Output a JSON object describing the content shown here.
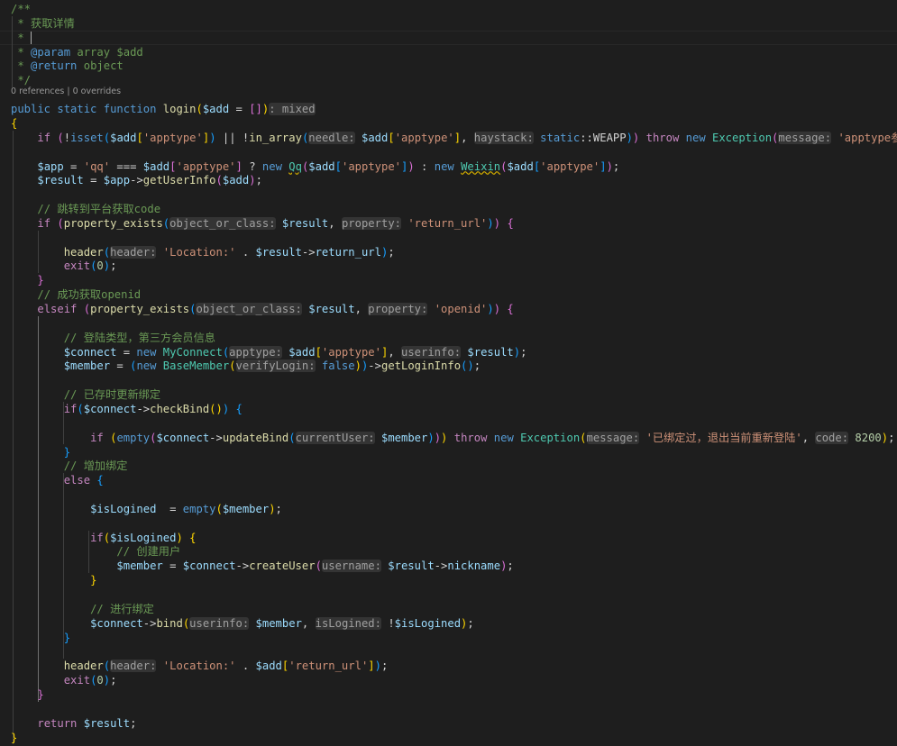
{
  "codelens": "0 references | 0 overrides",
  "lines": [
    [
      [
        "/**",
        "cm"
      ]
    ],
    [
      [
        " * 获取详情",
        "cm"
      ]
    ],
    [
      [
        " * ",
        "cm"
      ]
    ],
    [
      [
        " * ",
        "cm"
      ],
      [
        "@param",
        "doc"
      ],
      [
        " array $add",
        "cm"
      ]
    ],
    [
      [
        " * ",
        "cm"
      ],
      [
        "@return",
        "doc"
      ],
      [
        " object",
        "cm"
      ]
    ],
    [
      [
        " */",
        "cm"
      ]
    ],
    [
      [
        "public",
        "kw"
      ],
      [
        " ",
        "plain"
      ],
      [
        "static",
        "kw"
      ],
      [
        " ",
        "plain"
      ],
      [
        "function",
        "kw"
      ],
      [
        " ",
        "plain"
      ],
      [
        "login",
        "fn"
      ],
      [
        "(",
        "br1"
      ],
      [
        "$add",
        "var"
      ],
      [
        " = ",
        "op"
      ],
      [
        "[]",
        "br2"
      ],
      [
        ")",
        "br1"
      ],
      [
        ": mixed",
        "hint"
      ]
    ],
    [
      [
        "{",
        "br1"
      ]
    ],
    [
      [
        "    ",
        "plain"
      ],
      [
        "if",
        "ctl"
      ],
      [
        " ",
        "plain"
      ],
      [
        "(",
        "br2"
      ],
      [
        "!",
        "op"
      ],
      [
        "isset",
        "kw"
      ],
      [
        "(",
        "br3"
      ],
      [
        "$add",
        "var"
      ],
      [
        "[",
        "br1"
      ],
      [
        "'apptype'",
        "str"
      ],
      [
        "]",
        "br1"
      ],
      [
        ")",
        "br3"
      ],
      [
        " || !",
        "op"
      ],
      [
        "in_array",
        "fn"
      ],
      [
        "(",
        "br3"
      ],
      [
        "needle:",
        "hint"
      ],
      [
        " ",
        "plain"
      ],
      [
        "$add",
        "var"
      ],
      [
        "[",
        "br1"
      ],
      [
        "'apptype'",
        "str"
      ],
      [
        "]",
        "br1"
      ],
      [
        ", ",
        "op"
      ],
      [
        "haystack:",
        "hint"
      ],
      [
        " ",
        "plain"
      ],
      [
        "static",
        "kw"
      ],
      [
        "::",
        "op"
      ],
      [
        "WEAPP",
        "plain"
      ],
      [
        ")",
        "br3"
      ],
      [
        ")",
        "br2"
      ],
      [
        " ",
        "plain"
      ],
      [
        "throw",
        "ctl"
      ],
      [
        " ",
        "plain"
      ],
      [
        "new",
        "kw"
      ],
      [
        " ",
        "plain"
      ],
      [
        "Exception",
        "cls"
      ],
      [
        "(",
        "br2"
      ],
      [
        "message:",
        "hint"
      ],
      [
        " ",
        "plain"
      ],
      [
        "'apptype参数错误",
        "str"
      ]
    ],
    [],
    [
      [
        "    ",
        "plain"
      ],
      [
        "$app",
        "var"
      ],
      [
        " = ",
        "op"
      ],
      [
        "'qq'",
        "str"
      ],
      [
        " === ",
        "op"
      ],
      [
        "$add",
        "var"
      ],
      [
        "[",
        "br2"
      ],
      [
        "'apptype'",
        "str"
      ],
      [
        "]",
        "br2"
      ],
      [
        " ? ",
        "op"
      ],
      [
        "new",
        "kw"
      ],
      [
        " ",
        "plain"
      ],
      [
        "Qq",
        "cls sq"
      ],
      [
        "(",
        "br2"
      ],
      [
        "$add",
        "var"
      ],
      [
        "[",
        "br3"
      ],
      [
        "'apptype'",
        "str"
      ],
      [
        "]",
        "br3"
      ],
      [
        ")",
        "br2"
      ],
      [
        " : ",
        "op"
      ],
      [
        "new",
        "kw"
      ],
      [
        " ",
        "plain"
      ],
      [
        "Weixin",
        "cls sq"
      ],
      [
        "(",
        "br2"
      ],
      [
        "$add",
        "var"
      ],
      [
        "[",
        "br3"
      ],
      [
        "'apptype'",
        "str"
      ],
      [
        "]",
        "br3"
      ],
      [
        ")",
        "br2"
      ],
      [
        ";",
        "op"
      ]
    ],
    [
      [
        "    ",
        "plain"
      ],
      [
        "$result",
        "var"
      ],
      [
        " = ",
        "op"
      ],
      [
        "$app",
        "var"
      ],
      [
        "->",
        "op"
      ],
      [
        "getUserInfo",
        "fn"
      ],
      [
        "(",
        "br2"
      ],
      [
        "$add",
        "var"
      ],
      [
        ")",
        "br2"
      ],
      [
        ";",
        "op"
      ]
    ],
    [],
    [
      [
        "    ",
        "plain"
      ],
      [
        "// 跳转到平台获取code",
        "cm"
      ]
    ],
    [
      [
        "    ",
        "plain"
      ],
      [
        "if",
        "ctl"
      ],
      [
        " ",
        "plain"
      ],
      [
        "(",
        "br2"
      ],
      [
        "property_exists",
        "fn"
      ],
      [
        "(",
        "br3"
      ],
      [
        "object_or_class:",
        "hint"
      ],
      [
        " ",
        "plain"
      ],
      [
        "$result",
        "var"
      ],
      [
        ", ",
        "op"
      ],
      [
        "property:",
        "hint"
      ],
      [
        " ",
        "plain"
      ],
      [
        "'return_url'",
        "str"
      ],
      [
        ")",
        "br3"
      ],
      [
        ")",
        "br2"
      ],
      [
        " ",
        "plain"
      ],
      [
        "{",
        "br2"
      ]
    ],
    [],
    [
      [
        "        ",
        "plain"
      ],
      [
        "header",
        "fn"
      ],
      [
        "(",
        "br3"
      ],
      [
        "header:",
        "hint"
      ],
      [
        " ",
        "plain"
      ],
      [
        "'Location:'",
        "str"
      ],
      [
        " . ",
        "op"
      ],
      [
        "$result",
        "var"
      ],
      [
        "->",
        "op"
      ],
      [
        "return_url",
        "var"
      ],
      [
        ")",
        "br3"
      ],
      [
        ";",
        "op"
      ]
    ],
    [
      [
        "        ",
        "plain"
      ],
      [
        "exit",
        "ctl"
      ],
      [
        "(",
        "br3"
      ],
      [
        "0",
        "num"
      ],
      [
        ")",
        "br3"
      ],
      [
        ";",
        "op"
      ]
    ],
    [
      [
        "    ",
        "plain"
      ],
      [
        "}",
        "br2"
      ]
    ],
    [
      [
        "    ",
        "plain"
      ],
      [
        "// 成功获取openid",
        "cm"
      ]
    ],
    [
      [
        "    ",
        "plain"
      ],
      [
        "elseif",
        "ctl"
      ],
      [
        " ",
        "plain"
      ],
      [
        "(",
        "br2"
      ],
      [
        "property_exists",
        "fn"
      ],
      [
        "(",
        "br3"
      ],
      [
        "object_or_class:",
        "hint"
      ],
      [
        " ",
        "plain"
      ],
      [
        "$result",
        "var"
      ],
      [
        ", ",
        "op"
      ],
      [
        "property:",
        "hint"
      ],
      [
        " ",
        "plain"
      ],
      [
        "'openid'",
        "str"
      ],
      [
        ")",
        "br3"
      ],
      [
        ")",
        "br2"
      ],
      [
        " ",
        "plain"
      ],
      [
        "{",
        "br2"
      ]
    ],
    [],
    [
      [
        "        ",
        "plain"
      ],
      [
        "// 登陆类型，第三方会员信息",
        "cm"
      ]
    ],
    [
      [
        "        ",
        "plain"
      ],
      [
        "$connect",
        "var"
      ],
      [
        " = ",
        "op"
      ],
      [
        "new",
        "kw"
      ],
      [
        " ",
        "plain"
      ],
      [
        "MyConnect",
        "cls"
      ],
      [
        "(",
        "br3"
      ],
      [
        "apptype:",
        "hint"
      ],
      [
        " ",
        "plain"
      ],
      [
        "$add",
        "var"
      ],
      [
        "[",
        "br1"
      ],
      [
        "'apptype'",
        "str"
      ],
      [
        "]",
        "br1"
      ],
      [
        ", ",
        "op"
      ],
      [
        "userinfo:",
        "hint"
      ],
      [
        " ",
        "plain"
      ],
      [
        "$result",
        "var"
      ],
      [
        ")",
        "br3"
      ],
      [
        ";",
        "op"
      ]
    ],
    [
      [
        "        ",
        "plain"
      ],
      [
        "$member",
        "var"
      ],
      [
        " = ",
        "op"
      ],
      [
        "(",
        "br3"
      ],
      [
        "new",
        "kw"
      ],
      [
        " ",
        "plain"
      ],
      [
        "BaseMember",
        "cls"
      ],
      [
        "(",
        "br1"
      ],
      [
        "verifyLogin:",
        "hint"
      ],
      [
        " ",
        "plain"
      ],
      [
        "false",
        "kw"
      ],
      [
        ")",
        "br1"
      ],
      [
        ")",
        "br3"
      ],
      [
        "->",
        "op"
      ],
      [
        "getLoginInfo",
        "fn"
      ],
      [
        "(",
        "br3"
      ],
      [
        ")",
        "br3"
      ],
      [
        ";",
        "op"
      ]
    ],
    [],
    [
      [
        "        ",
        "plain"
      ],
      [
        "// 已存时更新绑定",
        "cm"
      ]
    ],
    [
      [
        "        ",
        "plain"
      ],
      [
        "if",
        "ctl"
      ],
      [
        "(",
        "br3"
      ],
      [
        "$connect",
        "var"
      ],
      [
        "->",
        "op"
      ],
      [
        "checkBind",
        "fn"
      ],
      [
        "(",
        "br1"
      ],
      [
        ")",
        "br1"
      ],
      [
        ")",
        "br3"
      ],
      [
        " ",
        "plain"
      ],
      [
        "{",
        "br3"
      ]
    ],
    [],
    [
      [
        "            ",
        "plain"
      ],
      [
        "if",
        "ctl"
      ],
      [
        " ",
        "plain"
      ],
      [
        "(",
        "br1"
      ],
      [
        "empty",
        "kw"
      ],
      [
        "(",
        "br2"
      ],
      [
        "$connect",
        "var"
      ],
      [
        "->",
        "op"
      ],
      [
        "updateBind",
        "fn"
      ],
      [
        "(",
        "br3"
      ],
      [
        "currentUser:",
        "hint"
      ],
      [
        " ",
        "plain"
      ],
      [
        "$member",
        "var"
      ],
      [
        ")",
        "br3"
      ],
      [
        ")",
        "br2"
      ],
      [
        ")",
        "br1"
      ],
      [
        " ",
        "plain"
      ],
      [
        "throw",
        "ctl"
      ],
      [
        " ",
        "plain"
      ],
      [
        "new",
        "kw"
      ],
      [
        " ",
        "plain"
      ],
      [
        "Exception",
        "cls"
      ],
      [
        "(",
        "br1"
      ],
      [
        "message:",
        "hint"
      ],
      [
        " ",
        "plain"
      ],
      [
        "'已绑定过，退出当前重新登陆'",
        "str"
      ],
      [
        ", ",
        "op"
      ],
      [
        "code:",
        "hint"
      ],
      [
        " ",
        "plain"
      ],
      [
        "8200",
        "num"
      ],
      [
        ")",
        "br1"
      ],
      [
        ";",
        "op"
      ]
    ],
    [
      [
        "        ",
        "plain"
      ],
      [
        "}",
        "br3"
      ]
    ],
    [
      [
        "        ",
        "plain"
      ],
      [
        "// 增加绑定",
        "cm"
      ]
    ],
    [
      [
        "        ",
        "plain"
      ],
      [
        "else",
        "ctl"
      ],
      [
        " ",
        "plain"
      ],
      [
        "{",
        "br3"
      ]
    ],
    [],
    [
      [
        "            ",
        "plain"
      ],
      [
        "$isLogined",
        "var"
      ],
      [
        "  = ",
        "op"
      ],
      [
        "empty",
        "kw"
      ],
      [
        "(",
        "br1"
      ],
      [
        "$member",
        "var"
      ],
      [
        ")",
        "br1"
      ],
      [
        ";",
        "op"
      ]
    ],
    [],
    [
      [
        "            ",
        "plain"
      ],
      [
        "if",
        "ctl"
      ],
      [
        "(",
        "br1"
      ],
      [
        "$isLogined",
        "var"
      ],
      [
        ")",
        "br1"
      ],
      [
        " ",
        "plain"
      ],
      [
        "{",
        "br1"
      ]
    ],
    [
      [
        "                ",
        "plain"
      ],
      [
        "// 创建用户",
        "cm"
      ]
    ],
    [
      [
        "                ",
        "plain"
      ],
      [
        "$member",
        "var"
      ],
      [
        " = ",
        "op"
      ],
      [
        "$connect",
        "var"
      ],
      [
        "->",
        "op"
      ],
      [
        "createUser",
        "fn"
      ],
      [
        "(",
        "br2"
      ],
      [
        "username:",
        "hint"
      ],
      [
        " ",
        "plain"
      ],
      [
        "$result",
        "var"
      ],
      [
        "->",
        "op"
      ],
      [
        "nickname",
        "var"
      ],
      [
        ")",
        "br2"
      ],
      [
        ";",
        "op"
      ]
    ],
    [
      [
        "            ",
        "plain"
      ],
      [
        "}",
        "br1"
      ]
    ],
    [],
    [
      [
        "            ",
        "plain"
      ],
      [
        "// 进行绑定",
        "cm"
      ]
    ],
    [
      [
        "            ",
        "plain"
      ],
      [
        "$connect",
        "var"
      ],
      [
        "->",
        "op"
      ],
      [
        "bind",
        "fn"
      ],
      [
        "(",
        "br1"
      ],
      [
        "userinfo:",
        "hint"
      ],
      [
        " ",
        "plain"
      ],
      [
        "$member",
        "var"
      ],
      [
        ", ",
        "op"
      ],
      [
        "isLogined:",
        "hint"
      ],
      [
        " !",
        "op"
      ],
      [
        "$isLogined",
        "var"
      ],
      [
        ")",
        "br1"
      ],
      [
        ";",
        "op"
      ]
    ],
    [
      [
        "        ",
        "plain"
      ],
      [
        "}",
        "br3"
      ]
    ],
    [],
    [
      [
        "        ",
        "plain"
      ],
      [
        "header",
        "fn"
      ],
      [
        "(",
        "br3"
      ],
      [
        "header:",
        "hint"
      ],
      [
        " ",
        "plain"
      ],
      [
        "'Location:'",
        "str"
      ],
      [
        " . ",
        "op"
      ],
      [
        "$add",
        "var"
      ],
      [
        "[",
        "br1"
      ],
      [
        "'return_url'",
        "str"
      ],
      [
        "]",
        "br1"
      ],
      [
        ")",
        "br3"
      ],
      [
        ";",
        "op"
      ]
    ],
    [
      [
        "        ",
        "plain"
      ],
      [
        "exit",
        "ctl"
      ],
      [
        "(",
        "br3"
      ],
      [
        "0",
        "num"
      ],
      [
        ")",
        "br3"
      ],
      [
        ";",
        "op"
      ]
    ],
    [
      [
        "    ",
        "plain"
      ],
      [
        "}",
        "br2"
      ]
    ],
    [],
    [
      [
        "    ",
        "plain"
      ],
      [
        "return",
        "ctl"
      ],
      [
        " ",
        "plain"
      ],
      [
        "$result",
        "var"
      ],
      [
        ";",
        "op"
      ]
    ],
    [
      [
        "}",
        "br1"
      ]
    ]
  ]
}
